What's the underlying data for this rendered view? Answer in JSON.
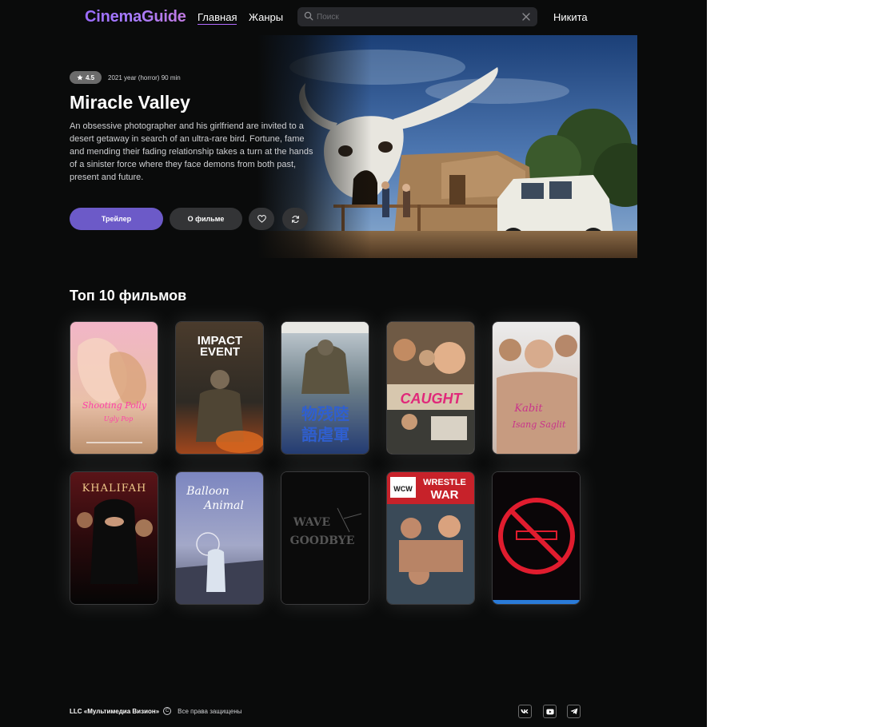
{
  "header": {
    "logo": "CinemaGuide",
    "nav": [
      {
        "label": "Главная",
        "active": true
      },
      {
        "label": "Жанры",
        "active": false
      }
    ],
    "search": {
      "placeholder": "Поиск",
      "value": ""
    },
    "user": "Никита"
  },
  "hero": {
    "rating": "4.5",
    "meta": "2021 year (horror) 90 min",
    "title": "Miracle Valley",
    "description": "An obsessive photographer and his girlfriend are invited to a desert getaway in search of an ultra-rare bird. Fortune, fame and mending their fading relationship takes a turn at the hands of a sinister force where they face demons from both past, present and future.",
    "buttons": {
      "trailer": "Трейлер",
      "about": "О фильме"
    }
  },
  "top10": {
    "title": "Топ 10 фильмов",
    "posters": [
      {
        "text": "Shooting Polly",
        "alt_text": "Ugly Pop"
      },
      {
        "text": "IMPACT",
        "alt_text": "EVENT"
      },
      {
        "text": "物残陸",
        "alt_text": "語虐軍"
      },
      {
        "text": "CAUGHT",
        "alt_text": ""
      },
      {
        "text": "Kabit",
        "alt_text": "Isang Saglit"
      },
      {
        "text": "KHALIFAH",
        "alt_text": ""
      },
      {
        "text": "Balloon",
        "alt_text": "Animal"
      },
      {
        "text": "WAVE",
        "alt_text": "GOODBYE"
      },
      {
        "text": "WRESTLE",
        "alt_text": "WAR"
      },
      {
        "text": "",
        "alt_text": ""
      }
    ]
  },
  "footer": {
    "company": "LLC «Мультимедиа Визион»",
    "copyright_symbol": "C",
    "rights": "Все права защищены",
    "social": [
      "vk",
      "youtube",
      "telegram"
    ]
  },
  "colors": {
    "accent": "#6c5ac8",
    "background": "#0a0b0b",
    "button_dark": "#333436",
    "nav_underline": "#b36bff"
  }
}
